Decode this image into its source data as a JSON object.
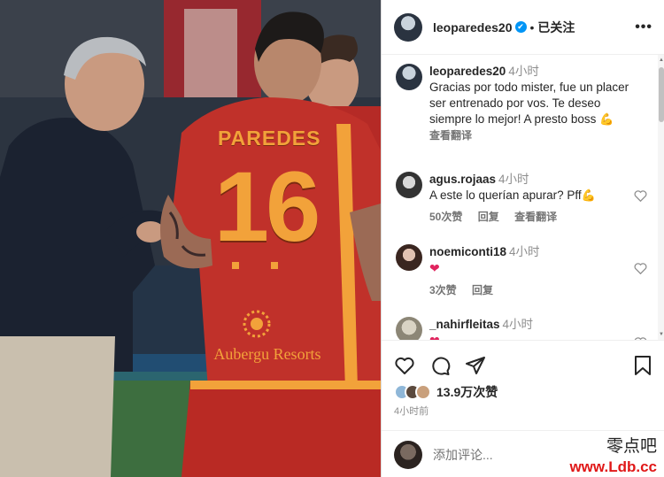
{
  "post_image": {
    "jersey_name": "PAREDES",
    "jersey_number": "16",
    "sponsor": "Aubergu Resorts"
  },
  "header": {
    "username": "leoparedes20",
    "verified_mark": "✔",
    "separator": "•",
    "follow_state": "已关注",
    "more_icon": "•••"
  },
  "caption": {
    "username": "leoparedes20",
    "time": "4小时",
    "text": "Gracias por todo mister, fue un placer ser entrenado por vos. Te deseo siempre lo mejor! A presto boss",
    "emoji": "💪",
    "translate": "查看翻译"
  },
  "comments": [
    {
      "username": "agus.rojaas",
      "time": "4小时",
      "text": "A este lo querían apurar? Pff",
      "emoji": "💪",
      "likes": "50次赞",
      "reply": "回复",
      "translate": "查看翻译"
    },
    {
      "username": "noemiconti18",
      "time": "4小时",
      "emoji": "❤",
      "likes": "3次赞",
      "reply": "回复"
    },
    {
      "username": "_nahirfleitas",
      "time": "4小时",
      "emoji": "❤"
    }
  ],
  "actions": {
    "likes_count": "13.9万次赞",
    "post_time": "4小时前",
    "add_comment_placeholder": "添加评论..."
  },
  "watermark": {
    "cn": "零点吧",
    "url": "www.Ldb.cc"
  },
  "colors": {
    "accent_blue": "#0095f6",
    "jersey_red": "#c0312a",
    "jersey_gold": "#f2a23a",
    "heart_red": "#e0245e"
  },
  "icons": [
    "more-icon",
    "verified-icon",
    "like-heart-icon",
    "comment-icon",
    "share-icon",
    "bookmark-icon",
    "scroll-up-icon",
    "scroll-down-icon"
  ]
}
